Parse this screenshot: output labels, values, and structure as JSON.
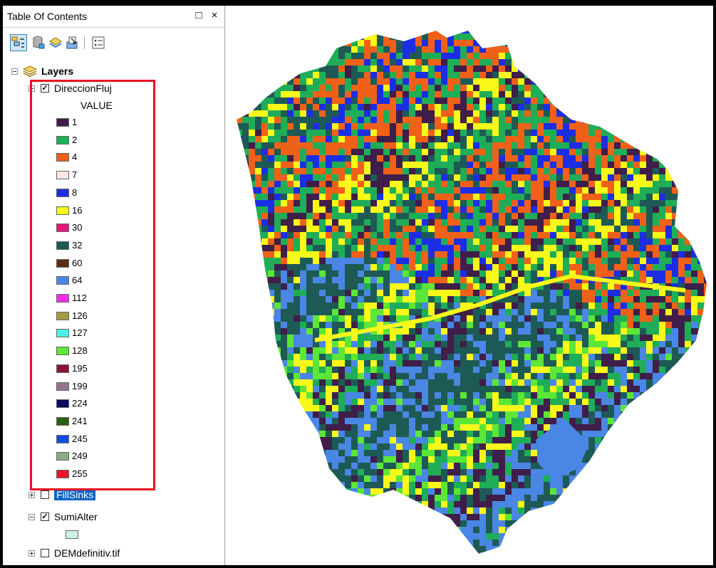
{
  "toc": {
    "title": "Table Of Contents",
    "restore_icon": "□",
    "close_icon": "×",
    "toolbar": [
      "list-by-drawing-order-icon",
      "list-by-source-icon",
      "list-by-visibility-icon",
      "list-by-selection-icon",
      "options-icon"
    ]
  },
  "layers": {
    "root_label": "Layers",
    "direccion": {
      "name": "DireccionFluj",
      "checked": true,
      "field": "VALUE",
      "legend": [
        {
          "value": "1",
          "color": "#3f1e4a"
        },
        {
          "value": "2",
          "color": "#1fad57"
        },
        {
          "value": "4",
          "color": "#ef6118"
        },
        {
          "value": "7",
          "color": "#fbe7e1"
        },
        {
          "value": "8",
          "color": "#1c2ee3"
        },
        {
          "value": "16",
          "color": "#f8f81a"
        },
        {
          "value": "30",
          "color": "#e6177a"
        },
        {
          "value": "32",
          "color": "#1e5a55"
        },
        {
          "value": "60",
          "color": "#5a3015"
        },
        {
          "value": "64",
          "color": "#4a86e4"
        },
        {
          "value": "112",
          "color": "#ed2fe6"
        },
        {
          "value": "126",
          "color": "#a39b45"
        },
        {
          "value": "127",
          "color": "#4ef1e8"
        },
        {
          "value": "128",
          "color": "#5ce637"
        },
        {
          "value": "195",
          "color": "#8e1330"
        },
        {
          "value": "199",
          "color": "#937593"
        },
        {
          "value": "224",
          "color": "#0b0b60"
        },
        {
          "value": "241",
          "color": "#2a5e16"
        },
        {
          "value": "245",
          "color": "#0f4ce8"
        },
        {
          "value": "249",
          "color": "#8eaa84"
        },
        {
          "value": "255",
          "color": "#e8172c"
        }
      ]
    },
    "fillsinks": {
      "name": "FillSinks",
      "checked": false
    },
    "sumialter": {
      "name": "SumiAlter",
      "checked": true,
      "swatch_color": "#cdf3e6"
    },
    "dem": {
      "name": "DEMdefinitiv.tif",
      "checked": false
    }
  },
  "highlight_color": "#e81224"
}
